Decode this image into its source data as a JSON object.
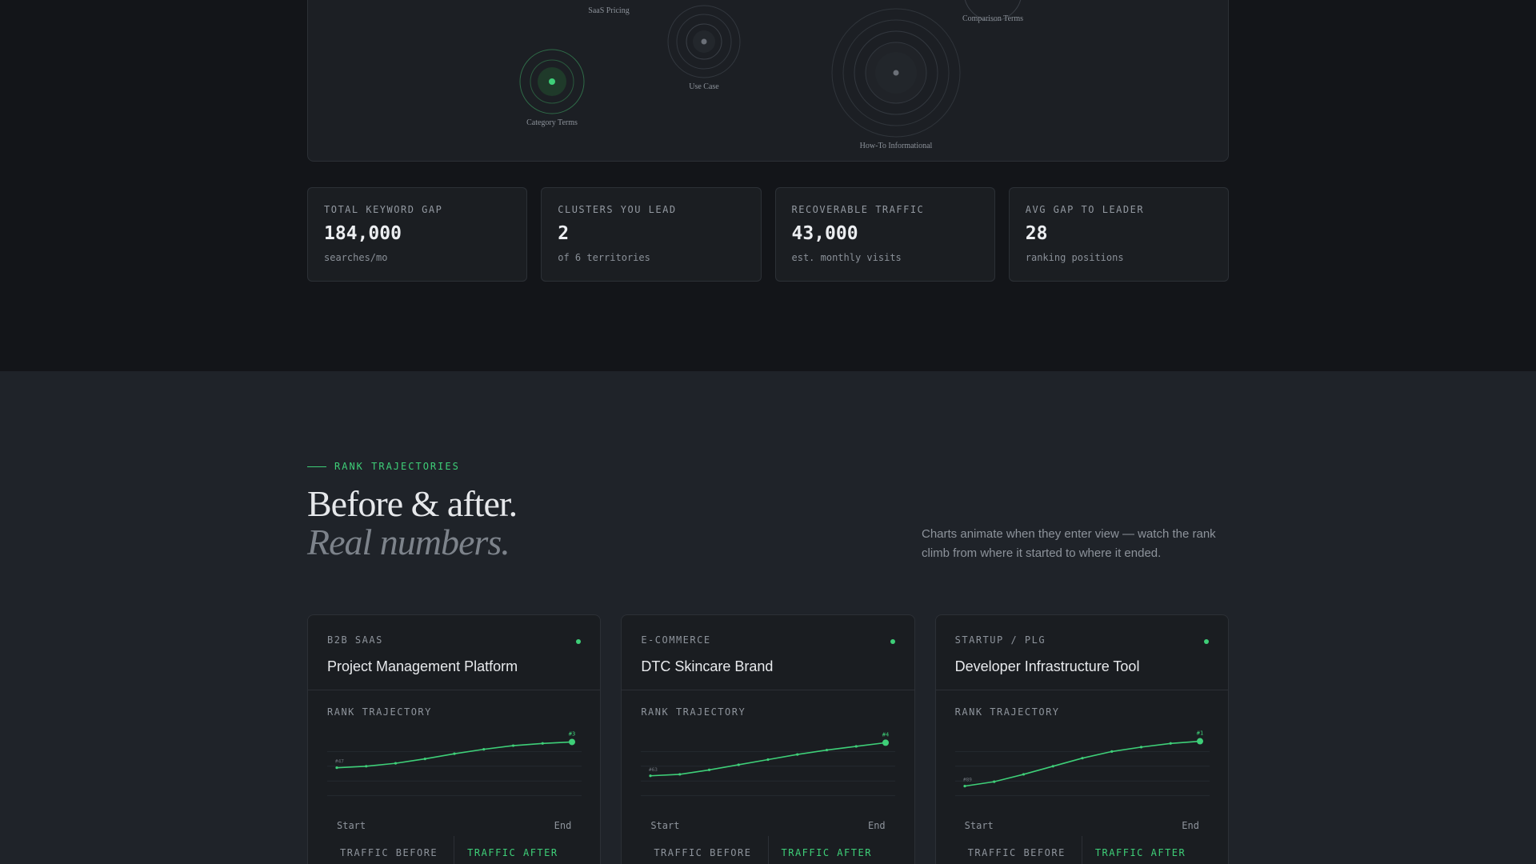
{
  "colors": {
    "accent": "#3ecf78",
    "panel": "#1c1f24",
    "background": "#131519",
    "section": "#1f2329"
  },
  "bubbles": [
    {
      "label": "SaaS Pricing",
      "highlight": false
    },
    {
      "label": "Use Case",
      "highlight": false
    },
    {
      "label": "Comparison Terms",
      "highlight": false
    },
    {
      "label": "Category Terms",
      "highlight": true
    },
    {
      "label": "How-To Informational",
      "highlight": false
    }
  ],
  "stats": [
    {
      "label": "TOTAL KEYWORD GAP",
      "value": "184,000",
      "sub": "searches/mo"
    },
    {
      "label": "CLUSTERS YOU LEAD",
      "value": "2",
      "sub": "of 6 territories"
    },
    {
      "label": "RECOVERABLE TRAFFIC",
      "value": "43,000",
      "sub": "est. monthly visits"
    },
    {
      "label": "AVG GAP TO LEADER",
      "value": "28",
      "sub": "ranking positions"
    }
  ],
  "section": {
    "eyebrow": "RANK TRAJECTORIES",
    "heading_line1": "Before & after.",
    "heading_line2": "Real numbers.",
    "description": "Charts animate when they enter view — watch the rank climb from where it started to where it ended."
  },
  "cards": [
    {
      "tag": "B2B SAAS",
      "title": "Project Management Platform",
      "chart_label": "RANK TRAJECTORY",
      "start_label": "Start",
      "end_label": "End",
      "traffic_before_label": "TRAFFIC BEFORE",
      "traffic_after_label": "TRAFFIC AFTER",
      "start_rank": "#47",
      "end_rank": "#3",
      "trajectory": [
        0.42,
        0.4,
        0.36,
        0.3,
        0.23,
        0.17,
        0.12,
        0.09,
        0.07
      ]
    },
    {
      "tag": "E-COMMERCE",
      "title": "DTC Skincare Brand",
      "chart_label": "RANK TRAJECTORY",
      "start_label": "Start",
      "end_label": "End",
      "traffic_before_label": "TRAFFIC BEFORE",
      "traffic_after_label": "TRAFFIC AFTER",
      "start_rank": "#63",
      "end_rank": "#4",
      "trajectory": [
        0.53,
        0.51,
        0.45,
        0.38,
        0.31,
        0.24,
        0.18,
        0.13,
        0.08
      ]
    },
    {
      "tag": "STARTUP / PLG",
      "title": "Developer Infrastructure Tool",
      "chart_label": "RANK TRAJECTORY",
      "start_label": "Start",
      "end_label": "End",
      "traffic_before_label": "TRAFFIC BEFORE",
      "traffic_after_label": "TRAFFIC AFTER",
      "start_rank": "#89",
      "end_rank": "#1",
      "trajectory": [
        0.67,
        0.61,
        0.51,
        0.4,
        0.29,
        0.2,
        0.14,
        0.09,
        0.06
      ]
    }
  ]
}
